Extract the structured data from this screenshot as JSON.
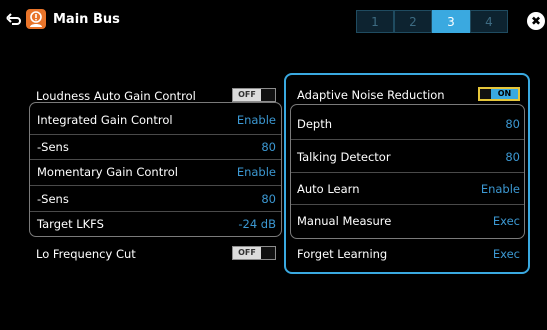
{
  "header": {
    "title": "Main Bus",
    "pages": [
      "1",
      "2",
      "3",
      "4"
    ],
    "active_page": "3",
    "close_symbol": "✖"
  },
  "left": {
    "loudness_label": "Loudness Auto Gain Control",
    "loudness_toggle": "OFF",
    "integrated_label": "Integrated Gain Control",
    "integrated_value": "Enable",
    "sens1_label": "-Sens",
    "sens1_value": "80",
    "momentary_label": "Momentary Gain Control",
    "momentary_value": "Enable",
    "sens2_label": "-Sens",
    "sens2_value": "80",
    "target_label": "Target LKFS",
    "target_value": "-24 dB",
    "lofreq_label": "Lo Frequency Cut",
    "lofreq_toggle": "OFF"
  },
  "right": {
    "anr_label": "Adaptive Noise Reduction",
    "anr_toggle": "ON",
    "depth_label": "Depth",
    "depth_value": "80",
    "talking_label": "Talking Detector",
    "talking_value": "80",
    "autolearn_label": "Auto Learn",
    "autolearn_value": "Enable",
    "manual_label": "Manual Measure",
    "manual_value": "Exec",
    "forget_label": "Forget Learning",
    "forget_value": "Exec"
  },
  "colors": {
    "accent": "#3aa9e0",
    "value": "#3c98d2",
    "toggle_on_border": "#e6c63a",
    "icon": "#e8742a"
  },
  "icons": {
    "back": "return-arrow-icon",
    "app": "alert-person-icon",
    "close": "close-icon"
  }
}
